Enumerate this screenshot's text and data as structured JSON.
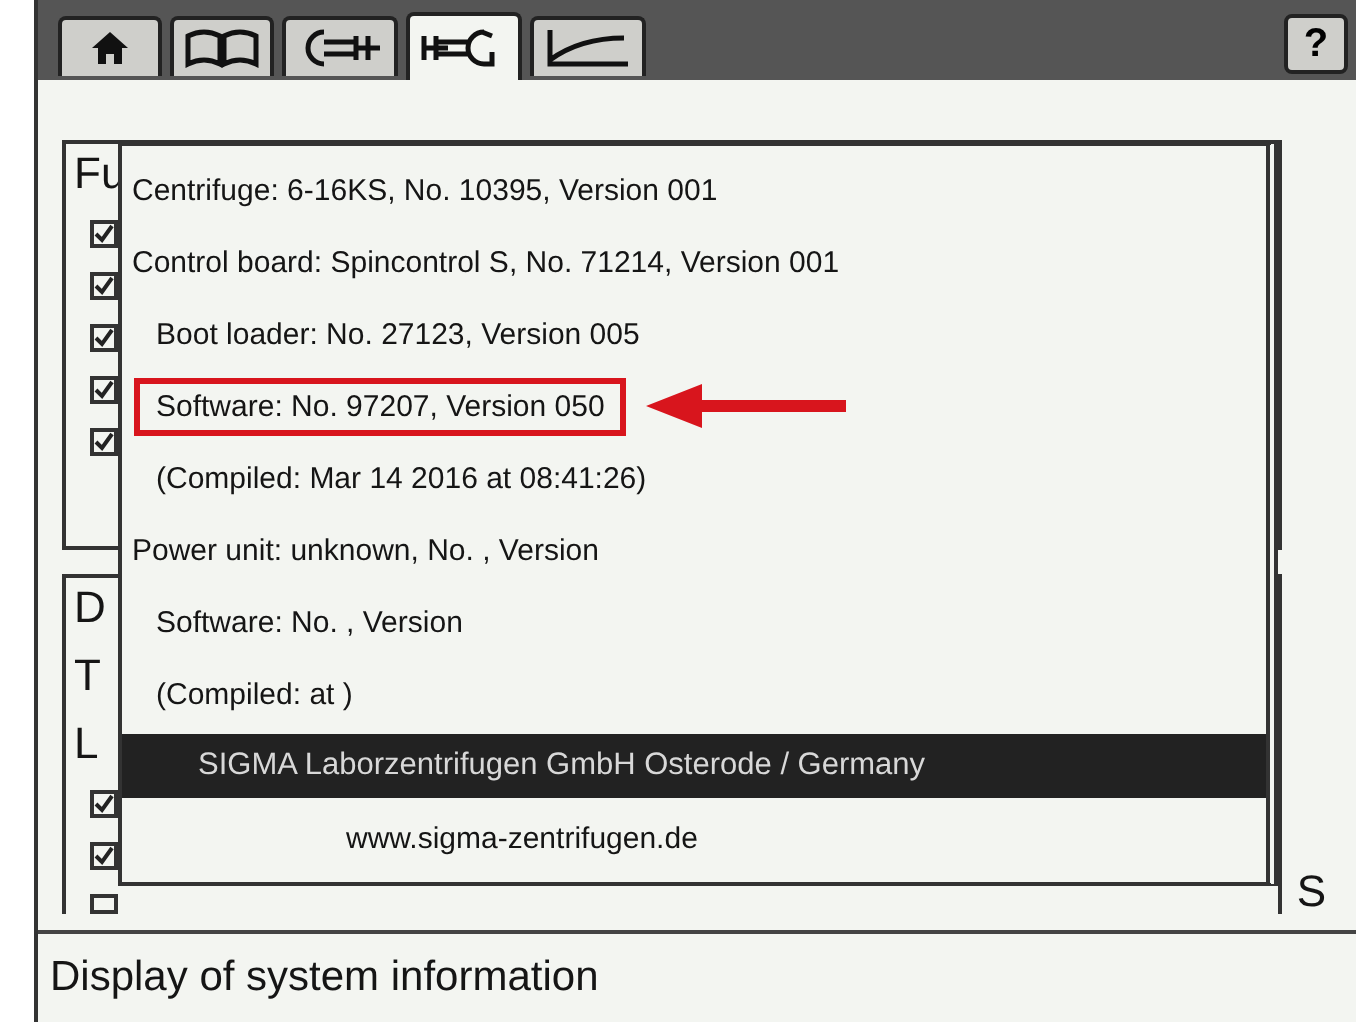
{
  "tabs": [
    {
      "kind": "home",
      "selected": false
    },
    {
      "kind": "book",
      "selected": false
    },
    {
      "kind": "tool",
      "selected": false
    },
    {
      "kind": "wrench",
      "selected": true
    },
    {
      "kind": "chart",
      "selected": false
    }
  ],
  "help_button": "?",
  "background_fragments": [
    "Fu",
    "D",
    "T",
    "L",
    "S"
  ],
  "checkboxes_1": [
    {
      "checked": true
    },
    {
      "checked": true
    },
    {
      "checked": true
    },
    {
      "checked": true
    },
    {
      "checked": true
    }
  ],
  "checkboxes_2": [
    {
      "checked": true
    },
    {
      "checked": true
    },
    {
      "checked": false
    }
  ],
  "info_popup": {
    "items": [
      {
        "text": "Centrifuge: 6-16KS, No. 10395, Version 001"
      },
      {
        "text": "Control board: Spincontrol S, No. 71214, Version 001",
        "children": [
          {
            "text": "Boot loader: No. 27123, Version 005",
            "annotated": false
          },
          {
            "text": "Software: No. 97207, Version 050",
            "annotated": true
          },
          {
            "text": "(Compiled: Mar 14 2016 at 08:41:26)",
            "annotated": false
          }
        ]
      },
      {
        "text": "Power unit: unknown, No. , Version",
        "children": [
          {
            "text": "Software: No. , Version",
            "annotated": false
          },
          {
            "text": "(Compiled:  at )",
            "annotated": false
          }
        ]
      }
    ],
    "banner": "SIGMA Laborzentrifugen GmbH Osterode / Germany",
    "website": "www.sigma-zentrifugen.de"
  },
  "status_bar": "Display of system information"
}
